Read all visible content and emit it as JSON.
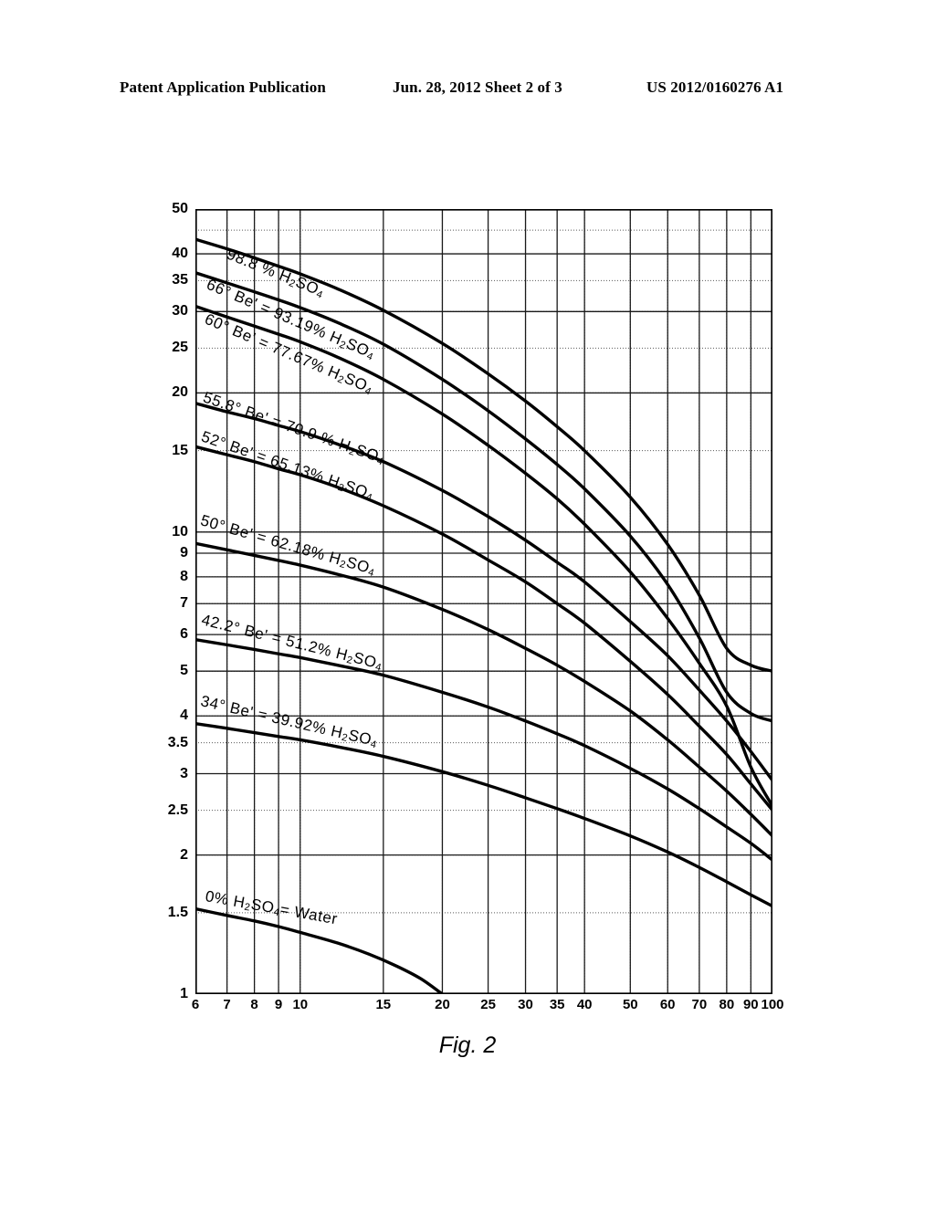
{
  "header": {
    "left": "Patent Application Publication",
    "middle": "Jun. 28, 2012  Sheet 2 of 3",
    "right": "US 2012/0160276 A1"
  },
  "figure": {
    "caption": "Fig. 2"
  },
  "chart_data": {
    "type": "line",
    "title": "",
    "xlabel": "",
    "ylabel": "",
    "xscale": "log",
    "yscale": "log",
    "xlim": [
      6,
      100
    ],
    "ylim": [
      1,
      50
    ],
    "grid": true,
    "legend": "inline-curve-labels",
    "xticks": [
      6,
      7,
      8,
      9,
      10,
      15,
      20,
      25,
      30,
      35,
      40,
      50,
      60,
      70,
      80,
      90,
      100
    ],
    "xtick_labels": [
      "6",
      "7",
      "8",
      "9",
      "10",
      "15",
      "20",
      "25",
      "30",
      "35",
      "40",
      "50",
      "60",
      "70",
      "80",
      "90",
      "100"
    ],
    "yticks": [
      1,
      1.5,
      2,
      2.5,
      3,
      3.5,
      4,
      5,
      6,
      7,
      8,
      9,
      10,
      15,
      20,
      25,
      30,
      35,
      40,
      50
    ],
    "ytick_labels": [
      "1",
      "1.5",
      "2",
      "2.5",
      "3",
      "3.5",
      "4",
      "5",
      "6",
      "7",
      "8",
      "9",
      "10",
      "15",
      "20",
      "25",
      "30",
      "35",
      "40",
      "50"
    ],
    "series": [
      {
        "name": "98.8 % H2SO4",
        "label": "98.8 % H<sub>2</sub>SO<sub>4</sub>",
        "label_x": 7.0,
        "label_y": 40.0,
        "label_angle": 22,
        "x": [
          6,
          7,
          8,
          9,
          10,
          12,
          15,
          20,
          25,
          30,
          35,
          40,
          50,
          60,
          70,
          80,
          90,
          100
        ],
        "y": [
          43.0,
          41.0,
          39.2,
          37.6,
          36.2,
          33.6,
          30.2,
          25.6,
          22.0,
          19.2,
          16.9,
          15.0,
          11.9,
          9.4,
          7.3,
          5.6,
          5.15,
          5.0
        ]
      },
      {
        "name": "66 deg Be' = 93.19% H2SO4",
        "label": "66° Be' = 93.19%  H<sub>2</sub>SO<sub>4</sub>",
        "label_x": 6.35,
        "label_y": 34.4,
        "label_angle": 23,
        "x": [
          6,
          7,
          8,
          9,
          10,
          12,
          15,
          20,
          25,
          30,
          35,
          40,
          50,
          60,
          70,
          80,
          90,
          100
        ],
        "y": [
          36.4,
          34.6,
          33.1,
          31.8,
          30.6,
          28.4,
          25.5,
          21.4,
          18.3,
          15.9,
          14.0,
          12.4,
          9.8,
          7.7,
          5.9,
          4.5,
          4.05,
          3.9
        ]
      },
      {
        "name": "60 deg Be' = 77.67% H2SO4",
        "label": "60° Be' = 77.67%  H<sub>2</sub>SO<sub>4</sub>",
        "label_x": 6.3,
        "label_y": 29.0,
        "label_angle": 23,
        "x": [
          6,
          7,
          8,
          9,
          10,
          12,
          15,
          20,
          25,
          30,
          35,
          40,
          50,
          60,
          70,
          80,
          90,
          100
        ],
        "y": [
          30.8,
          29.2,
          27.9,
          26.8,
          25.8,
          23.9,
          21.4,
          18.0,
          15.4,
          13.4,
          11.8,
          10.4,
          8.2,
          6.5,
          5.2,
          4.2,
          3.1,
          2.55
        ]
      },
      {
        "name": "55.8 deg Be' = 70.9 % H2SO4",
        "label": "55.8° Be' = 70.9 %  H<sub>2</sub>SO<sub>4</sub>",
        "label_x": 6.25,
        "label_y": 19.6,
        "label_angle": 19,
        "x": [
          6,
          7,
          8,
          9,
          10,
          12,
          15,
          20,
          25,
          30,
          35,
          40,
          50,
          60,
          70,
          80,
          90,
          100
        ],
        "y": [
          19.0,
          18.2,
          17.6,
          17.0,
          16.5,
          15.5,
          14.2,
          12.3,
          10.8,
          9.6,
          8.6,
          7.8,
          6.4,
          5.4,
          4.55,
          3.9,
          3.35,
          2.9
        ]
      },
      {
        "name": "52 deg Be' = 65.13% H2SO4",
        "label": "52° Be' = 65.13%  H<sub>2</sub>SO<sub>4</sub>",
        "label_x": 6.2,
        "label_y": 16.1,
        "label_angle": 19,
        "x": [
          6,
          7,
          8,
          9,
          10,
          12,
          15,
          20,
          25,
          30,
          35,
          40,
          50,
          60,
          70,
          80,
          90,
          100
        ],
        "y": [
          15.3,
          14.7,
          14.2,
          13.7,
          13.3,
          12.5,
          11.4,
          9.9,
          8.7,
          7.8,
          7.0,
          6.35,
          5.25,
          4.45,
          3.8,
          3.3,
          2.85,
          2.5
        ]
      },
      {
        "name": "50 deg Be' = 62.18% H2SO4",
        "label": "50° Be' = 62.18%  H<sub>2</sub>SO<sub>4</sub>",
        "label_x": 6.15,
        "label_y": 10.6,
        "label_angle": 16,
        "x": [
          6,
          7,
          8,
          9,
          10,
          12,
          15,
          20,
          25,
          30,
          35,
          40,
          50,
          60,
          70,
          80,
          90,
          100
        ],
        "y": [
          9.45,
          9.15,
          8.9,
          8.68,
          8.48,
          8.1,
          7.6,
          6.8,
          6.15,
          5.6,
          5.15,
          4.75,
          4.1,
          3.55,
          3.1,
          2.75,
          2.45,
          2.2
        ]
      },
      {
        "name": "42.2 deg Be' = 51.2% H2SO4",
        "label": "42.2° Be' = 51.2%  H<sub>2</sub>SO<sub>4</sub>",
        "label_x": 6.2,
        "label_y": 6.45,
        "label_angle": 14,
        "x": [
          6,
          7,
          8,
          9,
          10,
          12,
          15,
          20,
          25,
          30,
          35,
          40,
          50,
          60,
          70,
          80,
          90,
          100
        ],
        "y": [
          5.85,
          5.7,
          5.57,
          5.45,
          5.35,
          5.15,
          4.9,
          4.5,
          4.18,
          3.9,
          3.66,
          3.45,
          3.08,
          2.78,
          2.52,
          2.3,
          2.12,
          1.95
        ]
      },
      {
        "name": "34 deg Be' = 39.92% H2SO4",
        "label": "34° Be' = 39.92%  H<sub>2</sub>SO<sub>4</sub>",
        "label_x": 6.15,
        "label_y": 4.3,
        "label_angle": 13,
        "x": [
          6,
          7,
          8,
          9,
          10,
          12,
          15,
          20,
          25,
          30,
          35,
          40,
          50,
          60,
          70,
          80,
          90,
          100
        ],
        "y": [
          3.85,
          3.76,
          3.68,
          3.61,
          3.55,
          3.43,
          3.27,
          3.03,
          2.83,
          2.66,
          2.52,
          2.4,
          2.2,
          2.03,
          1.88,
          1.75,
          1.64,
          1.55
        ]
      },
      {
        "name": "0% H2SO4 = Water",
        "label": "0% H<sub>2</sub>SO<sub>4</sub>= Water",
        "label_x": 6.3,
        "label_y": 1.63,
        "label_angle": 10,
        "x": [
          6,
          7,
          8,
          9,
          10,
          12,
          14,
          16,
          18,
          20
        ],
        "y": [
          1.53,
          1.48,
          1.44,
          1.4,
          1.36,
          1.29,
          1.22,
          1.15,
          1.08,
          1.0
        ]
      }
    ]
  }
}
